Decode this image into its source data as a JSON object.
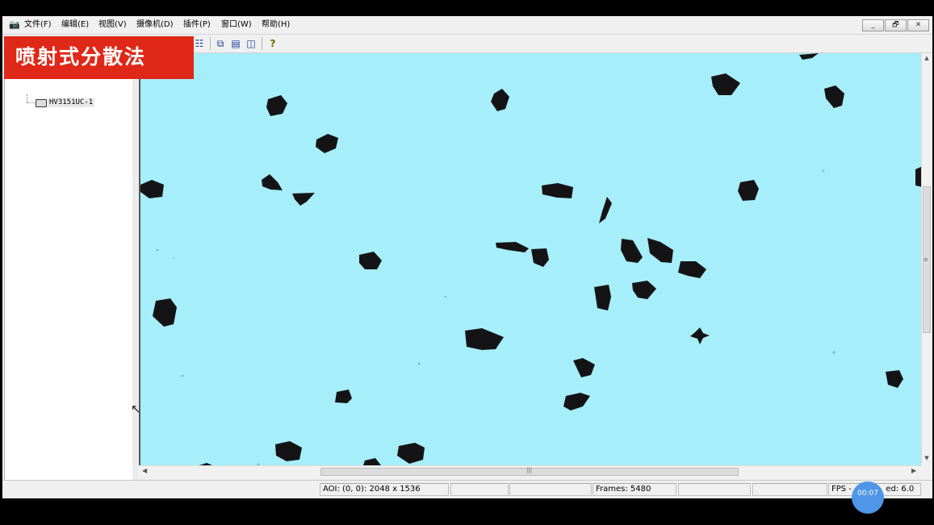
{
  "menubar": {
    "items": [
      "文件(F)",
      "编辑(E)",
      "视图(V)",
      "摄像机(D)",
      "插件(P)",
      "窗口(W)",
      "帮助(H)"
    ],
    "window_buttons": [
      "_",
      "🗗",
      "✕"
    ]
  },
  "banner": {
    "text": "喷射式分散法"
  },
  "tree": {
    "camera_label": "HV3151UC-1"
  },
  "viewport": {
    "background_color": "#a6eef9",
    "particle_color": "#141417"
  },
  "statusbar": {
    "aoi": "AOI: (0, 0): 2048 x 1536",
    "frames": "Frames: 5480",
    "fps_prefix": "FPS -",
    "fps_suffix": "ed: 6.0"
  },
  "recording_timer": "00:07"
}
